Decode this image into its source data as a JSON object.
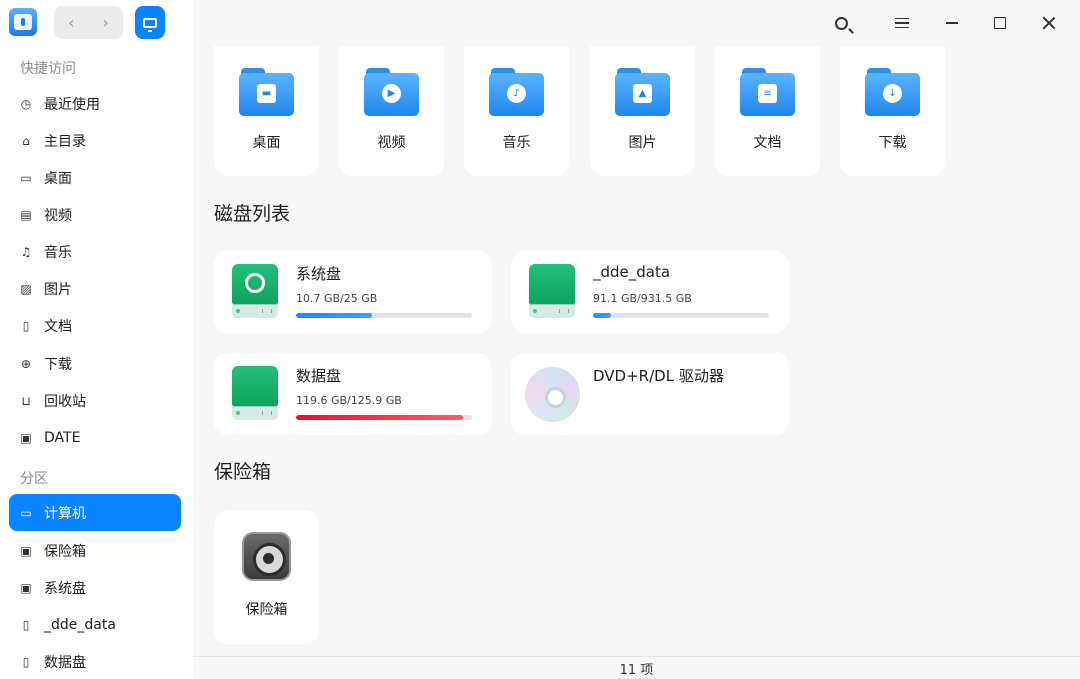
{
  "titlebar": {
    "app_icon": "file-manager-icon",
    "back_icon": "chevron-left-icon",
    "forward_icon": "chevron-right-icon",
    "view_icon": "computer-icon",
    "back_glyph": "‹",
    "forward_glyph": "›",
    "accent": "#0a84ff"
  },
  "sidebar": {
    "quick_access_label": "快捷访问",
    "partitions_label": "分区",
    "quick_items": [
      {
        "label": "最近使用",
        "icon": "clock-icon",
        "glyph": "◷"
      },
      {
        "label": "主目录",
        "icon": "home-icon",
        "glyph": "⌂"
      },
      {
        "label": "桌面",
        "icon": "desktop-icon",
        "glyph": "▭"
      },
      {
        "label": "视频",
        "icon": "film-icon",
        "glyph": "▤"
      },
      {
        "label": "音乐",
        "icon": "music-icon",
        "glyph": "♫"
      },
      {
        "label": "图片",
        "icon": "image-icon",
        "glyph": "▨"
      },
      {
        "label": "文档",
        "icon": "document-icon",
        "glyph": "▯"
      },
      {
        "label": "下载",
        "icon": "download-icon",
        "glyph": "⊕"
      },
      {
        "label": "回收站",
        "icon": "trash-icon",
        "glyph": "⊔"
      },
      {
        "label": "DATE",
        "icon": "bookmark-folder-icon",
        "glyph": "▣"
      }
    ],
    "partition_items": [
      {
        "label": "计算机",
        "icon": "computer-icon",
        "glyph": "▭",
        "active": true
      },
      {
        "label": "保险箱",
        "icon": "vault-icon",
        "glyph": "▣"
      },
      {
        "label": "系统盘",
        "icon": "disk-icon",
        "glyph": "▣"
      },
      {
        "label": "_dde_data",
        "icon": "disk-icon",
        "glyph": "▯"
      },
      {
        "label": "数据盘",
        "icon": "disk-icon",
        "glyph": "▯"
      }
    ]
  },
  "folders": [
    {
      "label": "桌面",
      "icon": "desktop-folder-icon",
      "emblem": "▬"
    },
    {
      "label": "视频",
      "icon": "video-folder-icon",
      "emblem": "▶"
    },
    {
      "label": "音乐",
      "icon": "music-folder-icon",
      "emblem": "♪"
    },
    {
      "label": "图片",
      "icon": "pictures-folder-icon",
      "emblem": "▲"
    },
    {
      "label": "文档",
      "icon": "documents-folder-icon",
      "emblem": "≡"
    },
    {
      "label": "下载",
      "icon": "downloads-folder-icon",
      "emblem": "↓"
    }
  ],
  "disks_section_title": "磁盘列表",
  "disks": [
    {
      "name": "系统盘",
      "size": "10.7 GB/25 GB",
      "usage": 0.43,
      "bar": "blue",
      "logo": true
    },
    {
      "name": "_dde_data",
      "size": "91.1 GB/931.5 GB",
      "usage": 0.1,
      "bar": "blue",
      "logo": false
    },
    {
      "name": "数据盘",
      "size": "119.6 GB/125.9 GB",
      "usage": 0.95,
      "bar": "red",
      "logo": false
    },
    {
      "name": "DVD+R/DL 驱动器",
      "icon": "optical-disc-icon"
    }
  ],
  "vault_section_title": "保险箱",
  "vault": {
    "label": "保险箱",
    "icon": "vault-safe-icon"
  },
  "status": {
    "item_count": "11 项"
  },
  "colors": {
    "accent": "#0a84ff",
    "disk_green": "#14b06a",
    "usage_red": "#e8112d"
  }
}
